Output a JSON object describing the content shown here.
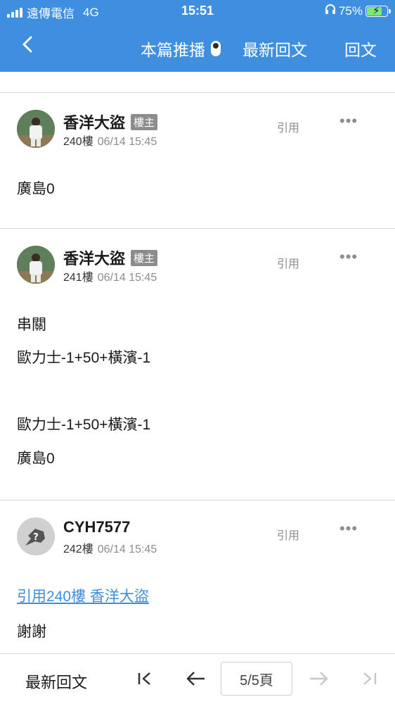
{
  "status_bar": {
    "carrier": "遠傳電信",
    "network": "4G",
    "time": "15:51",
    "battery": "75%"
  },
  "nav": {
    "push_label": "本篇推播",
    "latest_label": "最新回文",
    "reply_label": "回文"
  },
  "posts": [
    {
      "username": "香洋大盜",
      "badge": "樓主",
      "floor": "240樓",
      "date": "06/14 15:45",
      "quote_label": "引用",
      "more": "•••",
      "lines": [
        "廣島0"
      ]
    },
    {
      "username": "香洋大盜",
      "badge": "樓主",
      "floor": "241樓",
      "date": "06/14 15:45",
      "quote_label": "引用",
      "more": "•••",
      "lines": [
        "串關",
        "歐力士-1+50+橫濱-1",
        "歐力士-1+50+橫濱-1",
        "廣島0"
      ]
    },
    {
      "username": "CYH7577",
      "floor": "242樓",
      "date": "06/14 15:45",
      "quote_label": "引用",
      "more": "•••",
      "quote_link": "引用240樓 香洋大盜",
      "lines": [
        "謝謝"
      ]
    }
  ],
  "bottom_bar": {
    "latest_label": "最新回文",
    "page_indicator": "5/5頁"
  },
  "colors": {
    "header_blue": "#3f8ee0",
    "badge_gray": "#8c8c8c",
    "battery_green": "#7be87b"
  },
  "icons": {
    "back": "chevron-left-icon",
    "first": "first-page-icon",
    "prev": "arrow-left-icon",
    "next": "arrow-right-icon",
    "last": "last-page-icon",
    "headphones": "headphones-icon"
  }
}
